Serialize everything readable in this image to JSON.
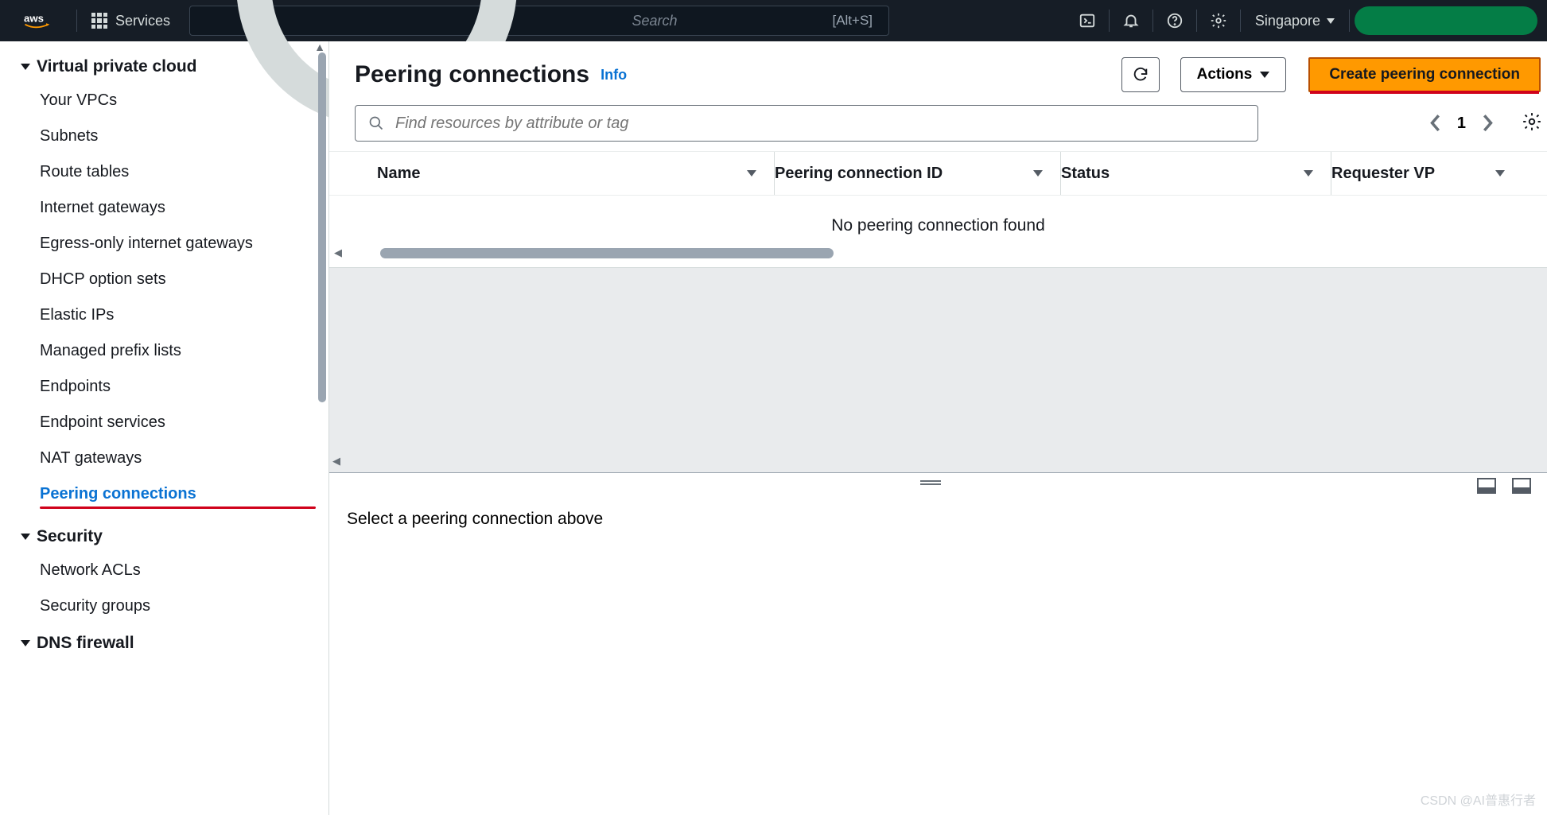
{
  "topnav": {
    "logo_text": "aws",
    "services_label": "Services",
    "search_placeholder": "Search",
    "search_shortcut": "[Alt+S]",
    "region_label": "Singapore"
  },
  "sidebar": {
    "sections": [
      {
        "title": "Virtual private cloud",
        "items": [
          {
            "label": "Your VPCs",
            "active": false
          },
          {
            "label": "Subnets",
            "active": false
          },
          {
            "label": "Route tables",
            "active": false
          },
          {
            "label": "Internet gateways",
            "active": false
          },
          {
            "label": "Egress-only internet gateways",
            "active": false
          },
          {
            "label": "DHCP option sets",
            "active": false
          },
          {
            "label": "Elastic IPs",
            "active": false
          },
          {
            "label": "Managed prefix lists",
            "active": false
          },
          {
            "label": "Endpoints",
            "active": false
          },
          {
            "label": "Endpoint services",
            "active": false
          },
          {
            "label": "NAT gateways",
            "active": false
          },
          {
            "label": "Peering connections",
            "active": true
          }
        ]
      },
      {
        "title": "Security",
        "items": [
          {
            "label": "Network ACLs",
            "active": false
          },
          {
            "label": "Security groups",
            "active": false
          }
        ]
      },
      {
        "title": "DNS firewall",
        "items": []
      }
    ]
  },
  "header": {
    "title": "Peering connections",
    "info_label": "Info",
    "actions_label": "Actions",
    "create_label": "Create peering connection"
  },
  "filter": {
    "placeholder": "Find resources by attribute or tag",
    "page_number": "1"
  },
  "table": {
    "columns": [
      "Name",
      "Peering connection ID",
      "Status",
      "Requester VP"
    ],
    "empty_message": "No peering connection found"
  },
  "detail": {
    "placeholder": "Select a peering connection above"
  },
  "watermark": "CSDN @AI普惠行者"
}
